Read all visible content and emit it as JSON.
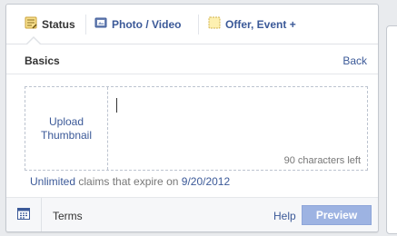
{
  "tabs": [
    {
      "label": "Status",
      "icon": "status-icon",
      "active": true
    },
    {
      "label": "Photo / Video",
      "icon": "photo-video-icon",
      "active": false
    },
    {
      "label": "Offer, Event +",
      "icon": "offer-event-icon",
      "active": false
    }
  ],
  "header": {
    "title": "Basics",
    "back_label": "Back"
  },
  "editor": {
    "thumbnail_line1": "Upload",
    "thumbnail_line2": "Thumbnail",
    "text_value": "",
    "chars_left": "90 characters left"
  },
  "expiry": {
    "limit_label": "Unlimited",
    "middle_text": "claims that expire on",
    "date_label": "9/20/2012"
  },
  "footer": {
    "calendar_icon": "calendar-icon",
    "terms_label": "Terms",
    "help_label": "Help",
    "preview_label": "Preview"
  },
  "colors": {
    "link": "#3b5998",
    "preview_button": "#9db3e2",
    "text": "#333333",
    "muted": "#777777"
  }
}
